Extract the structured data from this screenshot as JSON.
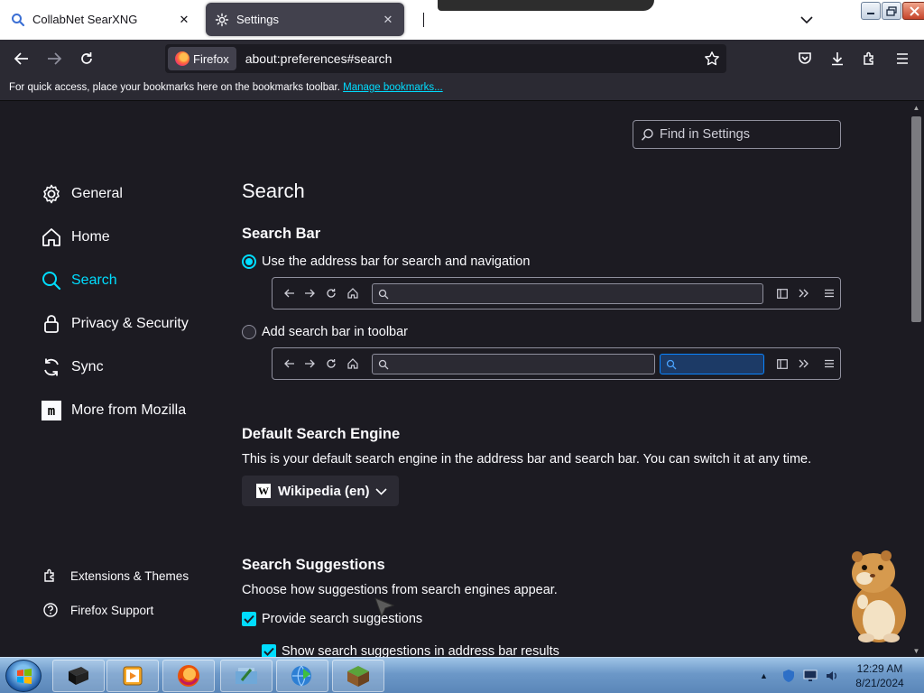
{
  "tabs": [
    {
      "title": "CollabNet SearXNG",
      "icon": "search-icon"
    },
    {
      "title": "Settings",
      "icon": "gear-icon"
    }
  ],
  "navbar": {
    "identity_label": "Firefox",
    "url": "about:preferences#search"
  },
  "bookmarks_bar": {
    "text": "For quick access, place your bookmarks here on the bookmarks toolbar.",
    "link": "Manage bookmarks..."
  },
  "find": {
    "placeholder": "Find in Settings"
  },
  "sidebar": {
    "items": [
      {
        "label": "General",
        "icon": "gear-icon"
      },
      {
        "label": "Home",
        "icon": "home-icon"
      },
      {
        "label": "Search",
        "icon": "search-icon",
        "active": true
      },
      {
        "label": "Privacy & Security",
        "icon": "lock-icon"
      },
      {
        "label": "Sync",
        "icon": "sync-icon"
      },
      {
        "label": "More from Mozilla",
        "icon": "mozilla-icon"
      }
    ],
    "footer": [
      {
        "label": "Extensions & Themes",
        "icon": "puzzle-icon"
      },
      {
        "label": "Firefox Support",
        "icon": "help-icon"
      }
    ]
  },
  "main": {
    "title": "Search",
    "search_bar": {
      "heading": "Search Bar",
      "option_address": "Use the address bar for search and navigation",
      "option_toolbar": "Add search bar in toolbar",
      "selected": "address"
    },
    "default_engine": {
      "heading": "Default Search Engine",
      "description": "This is your default search engine in the address bar and search bar. You can switch it at any time.",
      "selected": "Wikipedia (en)"
    },
    "suggestions": {
      "heading": "Search Suggestions",
      "description": "Choose how suggestions from search engines appear.",
      "provide_label": "Provide search suggestions",
      "provide_checked": true,
      "address_bar_label": "Show search suggestions in address bar results",
      "address_bar_checked": true
    }
  },
  "taskbar": {
    "time": "12:29 AM",
    "date": "8/21/2024"
  },
  "colors": {
    "accent": "#00ddff",
    "background": "#1c1b22",
    "toolbar": "#2b2a33"
  }
}
